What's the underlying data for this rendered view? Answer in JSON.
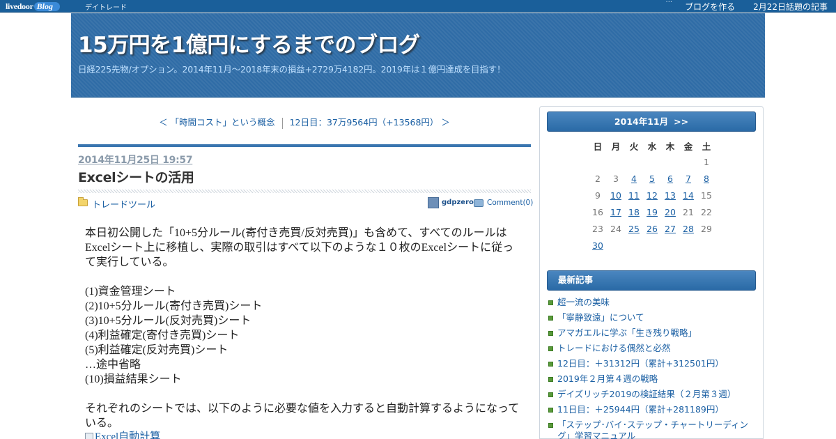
{
  "topbar": {
    "logo_main": "livedoor",
    "logo_blog": "Blog",
    "category": "デイトレード",
    "dots": "···",
    "create_blog": "ブログを作る",
    "topic_articles": "2月22日話題の記事"
  },
  "header": {
    "title": "15万円を1億円にするまでのブログ",
    "description": "日経225先物/オプション。2014年11月～2018年末の損益+2729万4182円。2019年は１億円達成を目指す！"
  },
  "nav": {
    "prev": "＜ 「時間コスト」という概念",
    "next": "12日目：37万9564円（+13568円） ＞"
  },
  "post": {
    "date": "2014年11月25日 19:57",
    "title": "Excelシートの活用",
    "category": "トレードツール",
    "author": "gdpzero",
    "comment": "Comment(0)",
    "paragraph1": "本日初公開した「10+5分ルール(寄付き売買/反対売買)」も含めて、すべてのルールはExcelシート上に移植し、実際の取引はすべて以下のような１０枚のExcelシートに従って実行している。",
    "list": [
      "(1)資金管理シート",
      "(2)10+5分ルール(寄付き売買)シート",
      "(3)10+5分ルール(反対売買)シート",
      "(4)利益確定(寄付き売買)シート",
      "(5)利益確定(反対売買)シート",
      "…途中省略",
      "(10)損益結果シート"
    ],
    "paragraph2": "それぞれのシートでは、以下のように必要な値を入力すると自動計算するようになっている。",
    "image_alt": "Excel自動計算"
  },
  "calendar": {
    "month": "2014年11月",
    "next": ">>",
    "weekdays": [
      "日",
      "月",
      "火",
      "水",
      "木",
      "金",
      "土"
    ],
    "weeks": [
      [
        "",
        "",
        "",
        "",
        "",
        "",
        "1"
      ],
      [
        "2",
        "3",
        "4",
        "5",
        "6",
        "7",
        "8"
      ],
      [
        "9",
        "10",
        "11",
        "12",
        "13",
        "14",
        "15"
      ],
      [
        "16",
        "17",
        "18",
        "19",
        "20",
        "21",
        "22"
      ],
      [
        "23",
        "24",
        "25",
        "26",
        "27",
        "28",
        "29"
      ],
      [
        "30",
        "",
        "",
        "",
        "",
        "",
        ""
      ]
    ],
    "linked_days": [
      "4",
      "5",
      "6",
      "7",
      "8",
      "10",
      "11",
      "12",
      "13",
      "14",
      "17",
      "18",
      "19",
      "20",
      "25",
      "26",
      "27",
      "28",
      "30"
    ]
  },
  "recent": {
    "heading": "最新記事",
    "items": [
      "超一流の美味",
      "「寧静致遠」について",
      "アマガエルに学ぶ「生き残り戦略」",
      "トレードにおける偶然と必然",
      "12日目：＋31312円（累計+312501円）",
      "2019年２月第４週の戦略",
      "デイズリッチ2019の検証結果（２月第３週）",
      "11日目：＋25944円（累計+281189円）",
      "「ステップ･バイ･ステップ・チャートリーディング」学習マニュアル"
    ]
  }
}
